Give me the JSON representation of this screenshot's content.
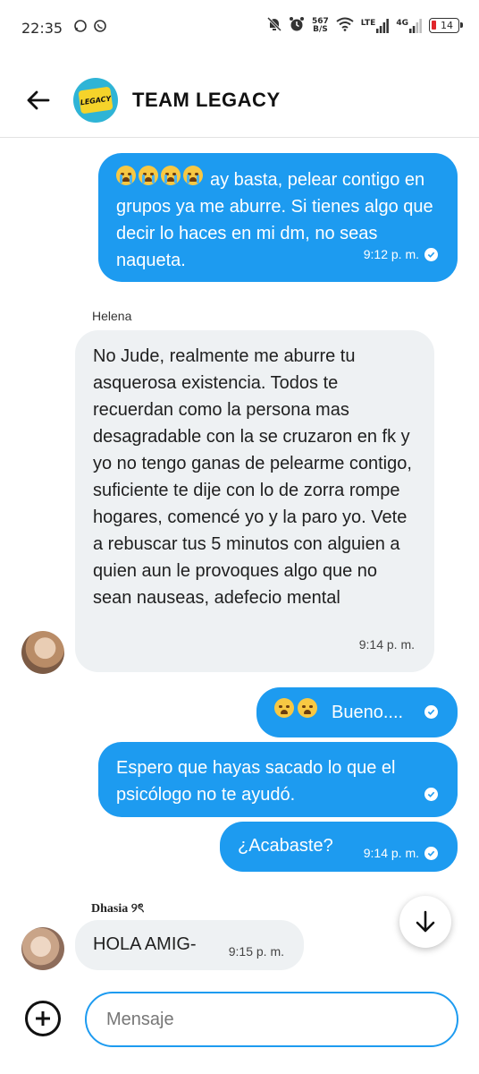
{
  "status_bar": {
    "time": "22:35",
    "net_speed_value": "567",
    "net_speed_unit": "B/S",
    "lte_label": "LTE",
    "net_4g_label": "4G",
    "battery_level": "14"
  },
  "header": {
    "title": "TEAM LEGACY",
    "avatar_text": "LEGACY"
  },
  "messages": [
    {
      "direction": "outgoing",
      "text": "ay basta, pelear contigo en grupos ya me aburre. Si tienes algo que decir lo haces en mi dm, no seas naqueta.",
      "emoji_prefix": "😭😭😭😭",
      "time": "9:12 p. m."
    },
    {
      "direction": "incoming",
      "sender": "Helena",
      "text": "No Jude, realmente me aburre tu asquerosa existencia. Todos te recuerdan como la persona mas desagradable con la se cruzaron en fk y yo no tengo ganas de pelearme contigo, suficiente te dije con lo de zorra rompe hogares, comencé yo y la paro yo. Vete a rebuscar tus 5 minutos con alguien a quien aun le provoques algo que no sean nauseas, adefecio mental",
      "time": "9:14 p. m."
    },
    {
      "direction": "outgoing",
      "text": "Bueno....",
      "emoji_prefix": "😩😩"
    },
    {
      "direction": "outgoing",
      "text": "Espero que hayas sacado lo que el psicólogo no te ayudó."
    },
    {
      "direction": "outgoing",
      "text": "¿Acabaste?",
      "time": "9:14 p. m."
    },
    {
      "direction": "incoming",
      "sender": "Dhasia ୨ৎ",
      "text": "HOLA AMIG-",
      "time": "9:15 p. m."
    }
  ],
  "composer": {
    "placeholder": "Mensaje"
  },
  "colors": {
    "outgoing_bubble": "#1d9bf0",
    "incoming_bubble": "#eef1f3",
    "input_border": "#1d9bf0"
  }
}
